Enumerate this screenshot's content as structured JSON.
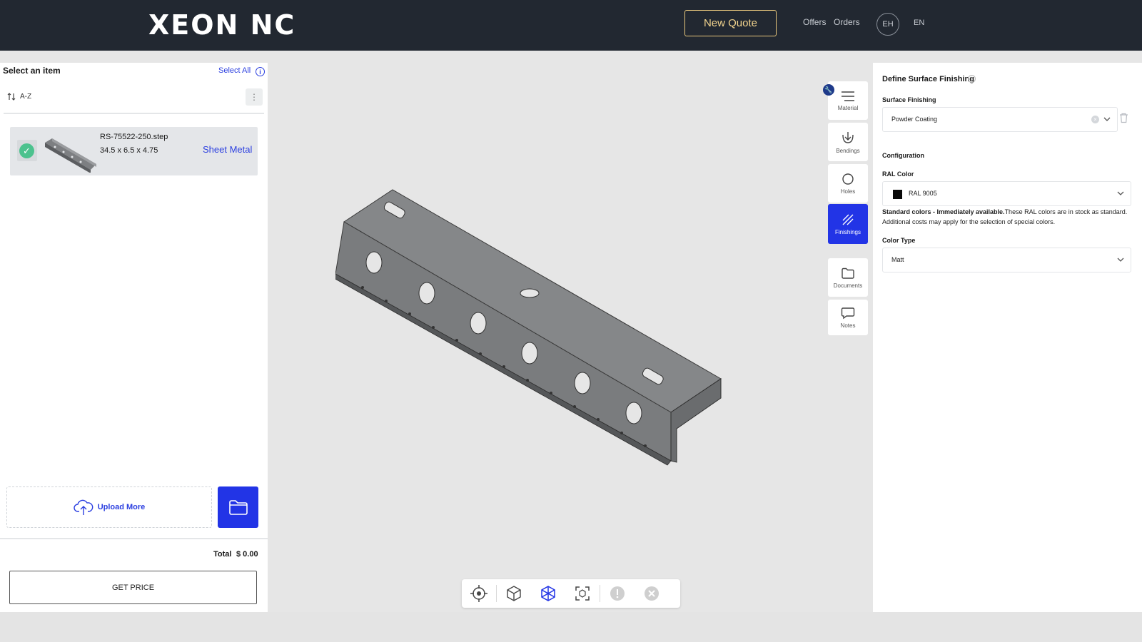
{
  "header": {
    "logo": "XEON NC",
    "new_quote": "New Quote",
    "offers": "Offers",
    "orders": "Orders",
    "avatar": "EH",
    "language": "EN"
  },
  "left_panel": {
    "title": "Select an item",
    "select_all": "Select All",
    "info_icon": "i",
    "sort_label": "A-Z",
    "kebab": "⋮",
    "items": [
      {
        "name": "RS-75522-250.step",
        "dims": "34.5 x 6.5 x 4.75",
        "type": "Sheet Metal",
        "checked": true
      }
    ],
    "upload_more": "Upload More",
    "total_label": "Total",
    "total_value": "$ 0.00",
    "get_price": "GET PRICE"
  },
  "tool_rail": {
    "items": [
      {
        "label": "Material",
        "icon": "menu-lines-icon",
        "active": false
      },
      {
        "label": "Bendings",
        "icon": "bend-arrow-icon",
        "active": false
      },
      {
        "label": "Holes",
        "icon": "circle-icon",
        "active": false
      },
      {
        "label": "Finishings",
        "icon": "hatch-icon",
        "active": true
      },
      {
        "label": "Documents",
        "icon": "folder-icon",
        "active": false
      },
      {
        "label": "Notes",
        "icon": "speech-bubble-icon",
        "active": false
      }
    ]
  },
  "right_panel": {
    "title": "Define Surface Finishing",
    "surface_finishing_label": "Surface Finishing",
    "surface_finishing_value": "Powder Coating",
    "configuration_label": "Configuration",
    "ral_color_label": "RAL Color",
    "ral_color_value": "RAL 9005",
    "ral_swatch": "#0a0a0a",
    "help_bold": "Standard colors - Immediately available.",
    "help_text": "These RAL colors are in stock as standard. Additional costs may apply for the selection of special colors.",
    "color_type_label": "Color Type",
    "color_type_value": "Matt"
  },
  "viewer_toolbar": {
    "buttons": [
      "target-icon",
      "cube-iso-icon",
      "cube-wire-icon",
      "fit-view-icon",
      "alert-icon",
      "close-icon"
    ]
  },
  "colors": {
    "header_bg": "#222831",
    "accent_blue": "#2234e6",
    "gold": "#e8c77c",
    "success": "#4cc28e"
  }
}
